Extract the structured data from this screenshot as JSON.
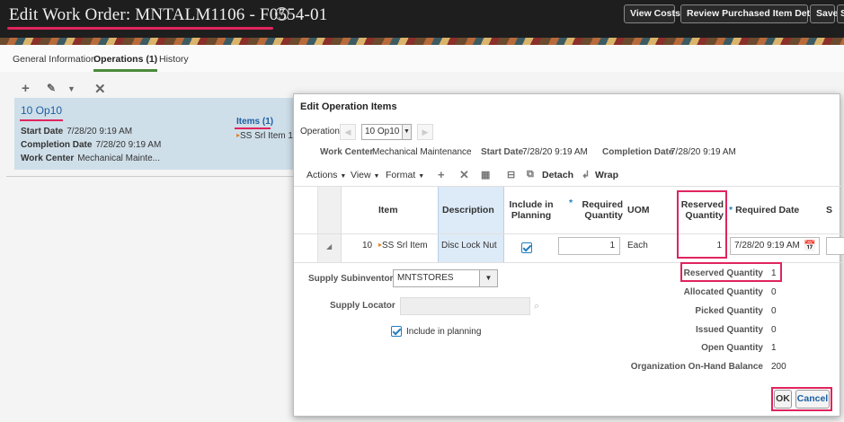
{
  "header": {
    "title": "Edit Work Order: MNTALM1106 - F0554-01",
    "help_icon": "help-icon",
    "buttons": [
      "View Costs",
      "Review Purchased Item Details",
      "Save",
      "S"
    ]
  },
  "tabs": [
    "General Information",
    "Operations (1)",
    "History"
  ],
  "active_tab": "Operations (1)",
  "toolbar_icons": [
    "add-icon",
    "edit-icon",
    "dropdown-icon",
    "delete-icon"
  ],
  "operation_card": {
    "name": "10 Op10",
    "start_date_label": "Start Date",
    "start_date": "7/28/20 9:19 AM",
    "completion_date_label": "Completion Date",
    "completion_date": "7/28/20 9:19 AM",
    "work_center_label": "Work Center",
    "work_center": "Mechanical Mainte...",
    "items_link": "Items (1)",
    "items_sub": "SS Srl Item 1"
  },
  "dialog": {
    "title": "Edit Operation Items",
    "operation_label": "Operation",
    "operation_value": "10 Op10",
    "work_center_label": "Work Center",
    "work_center": "Mechanical Maintenance",
    "start_date_label": "Start Date",
    "start_date": "7/28/20 9:19 AM",
    "completion_date_label": "Completion Date",
    "completion_date": "7/28/20 9:19 AM",
    "toolbar": {
      "actions": "Actions",
      "view": "View",
      "format": "Format",
      "detach": "Detach",
      "wrap": "Wrap"
    },
    "table": {
      "headers": {
        "item": "Item",
        "description": "Description",
        "include_in_planning": "Include in Planning",
        "required_quantity": "Required Quantity",
        "uom": "UOM",
        "reserved_quantity": "Reserved Quantity",
        "required_date": "Required Date",
        "last": "S"
      },
      "rows": [
        {
          "seq": "10",
          "item": "SS Srl Item",
          "description": "Disc Lock Nut",
          "include_in_planning": true,
          "required_quantity": "1",
          "uom": "Each",
          "reserved_quantity": "1",
          "required_date": "7/28/20 9:19 AM"
        }
      ]
    },
    "detail": {
      "supply_subinventory_label": "Supply Subinventory",
      "supply_subinventory": "MNTSTORES",
      "supply_locator_label": "Supply Locator",
      "supply_locator": "",
      "include_in_planning_label": "Include in planning",
      "include_in_planning": true,
      "quantities": [
        {
          "label": "Reserved Quantity",
          "value": "1"
        },
        {
          "label": "Allocated Quantity",
          "value": "0"
        },
        {
          "label": "Picked Quantity",
          "value": "0"
        },
        {
          "label": "Issued Quantity",
          "value": "0"
        },
        {
          "label": "Open Quantity",
          "value": "1"
        },
        {
          "label": "Organization On-Hand Balance",
          "value": "200"
        }
      ]
    },
    "ok_label": "OK",
    "cancel_label": "Cancel"
  },
  "colors": {
    "highlight": "#e0245e",
    "link": "#1c5fa3",
    "active_tab": "#4a8a3a",
    "card_bg": "#cfdfe9"
  }
}
